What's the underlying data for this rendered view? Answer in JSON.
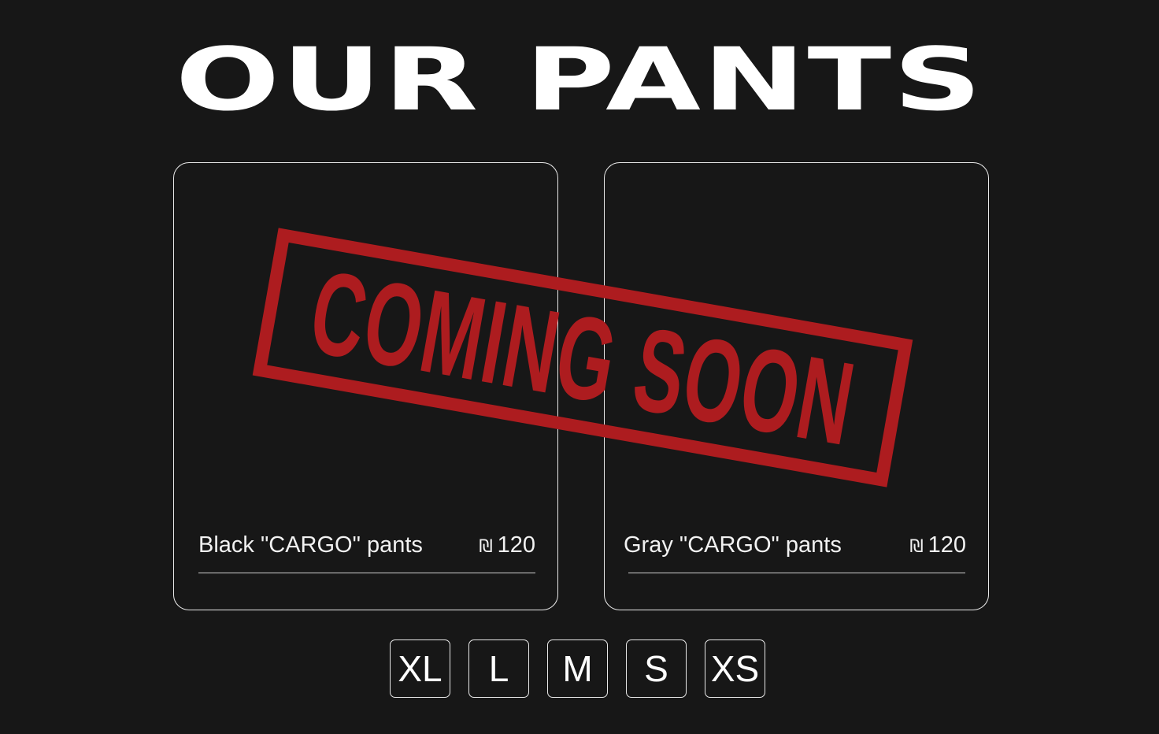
{
  "page": {
    "title": "OUR PANTS",
    "stamp_text": "COMING SOON"
  },
  "products": [
    {
      "name": "Black \"CARGO\" pants",
      "currency": "₪",
      "price": "120"
    },
    {
      "name": "Gray \"CARGO\" pants",
      "currency": "₪",
      "price": "120"
    }
  ],
  "sizes": [
    "XL",
    "L",
    "M",
    "S",
    "XS"
  ],
  "colors": {
    "background": "#171717",
    "text": "#ffffff",
    "stamp": "#ad1c1f",
    "border": "#e8e8e8"
  }
}
